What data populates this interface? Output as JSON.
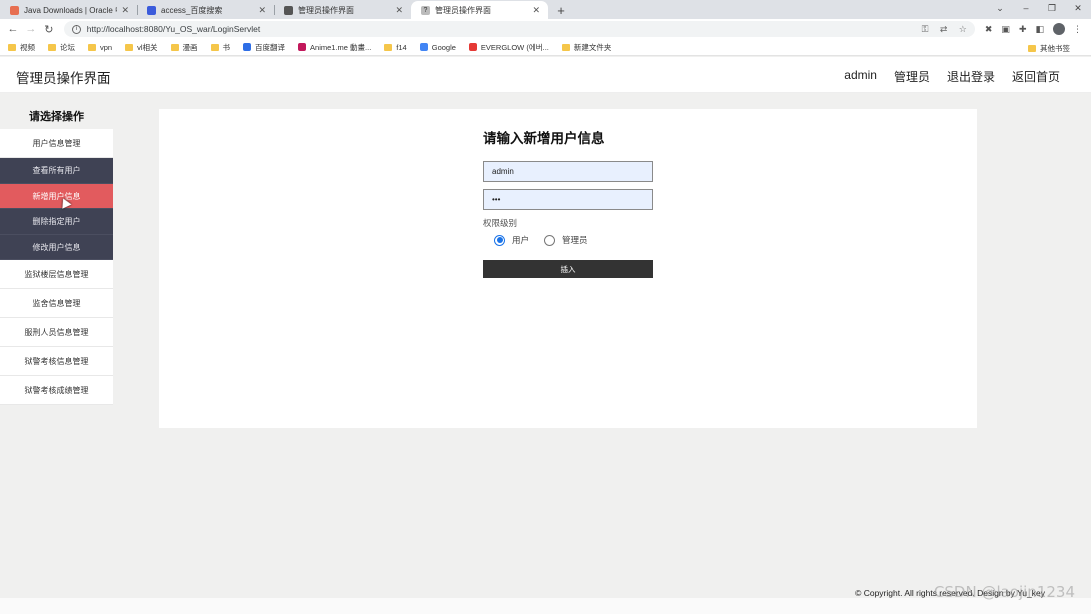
{
  "browser": {
    "tabs": [
      {
        "title": "Java Downloads | Oracle 中国",
        "favicon_color": "#e76f51",
        "active": false
      },
      {
        "title": "access_百度搜索",
        "favicon_color": "#3b5bdb",
        "active": false
      },
      {
        "title": "管理员操作界面",
        "favicon_color": "#555555",
        "active": false
      },
      {
        "title": "管理员操作界面",
        "favicon_color": "#999999",
        "active": true
      }
    ],
    "new_tab": "+",
    "url": "http://localhost:8080/Yu_OS_war/LoginServlet",
    "bookmarks": [
      {
        "label": "视频",
        "type": "folder"
      },
      {
        "label": "论坛",
        "type": "folder"
      },
      {
        "label": "vpn",
        "type": "folder"
      },
      {
        "label": "vl相关",
        "type": "folder"
      },
      {
        "label": "漫画",
        "type": "folder"
      },
      {
        "label": "书",
        "type": "folder"
      },
      {
        "label": "百度翻译",
        "type": "link",
        "color": "#2e6ee6"
      },
      {
        "label": "Anime1.me 動畫...",
        "type": "link",
        "color": "#c2185b"
      },
      {
        "label": "f14",
        "type": "folder"
      },
      {
        "label": "Google",
        "type": "link",
        "color": "#4285f4"
      },
      {
        "label": "EVERGLOW (에버...",
        "type": "link",
        "color": "#e53935"
      },
      {
        "label": "新建文件夹",
        "type": "folder"
      }
    ],
    "other_bookmarks": "其他书签"
  },
  "header": {
    "brand": "管理员操作界面",
    "nav": [
      "admin",
      "管理员",
      "退出登录",
      "返回首页"
    ]
  },
  "sidebar": {
    "heading": "请选择操作",
    "groups": [
      {
        "label": "用户信息管理",
        "children": [
          "查看所有用户",
          "新增用户信息",
          "删除指定用户",
          "修改用户信息"
        ],
        "active_child": 1
      },
      {
        "label": "监狱楼层信息管理"
      },
      {
        "label": "监舍信息管理"
      },
      {
        "label": "服刑人员信息管理"
      },
      {
        "label": "狱警考核信息管理"
      },
      {
        "label": "狱警考核成绩管理"
      }
    ]
  },
  "form": {
    "title": "请输入新增用户信息",
    "username_value": "admin",
    "password_value": "•••",
    "permission_label": "权限级别",
    "options": [
      "用户",
      "管理员"
    ],
    "selected_option": "用户",
    "submit_label": "插入"
  },
  "footer": {
    "copyright": "© Copyright. All rights reserved. Design by Yu_key",
    "watermark": "CSDN @laojin1234"
  },
  "colors": {
    "sidebar_dark": "#3f4254",
    "sidebar_active": "#e25b5e",
    "page_bg": "#f0f0ef",
    "submit_bg": "#333333"
  }
}
